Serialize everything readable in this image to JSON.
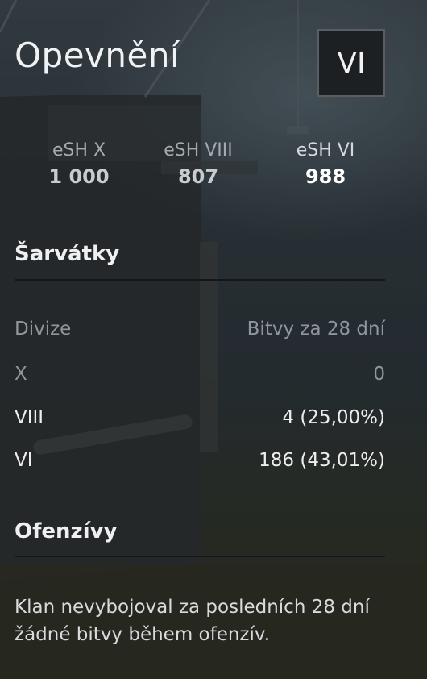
{
  "header": {
    "title": "Opevnění",
    "tier_badge": "VI"
  },
  "elo_ratings": [
    {
      "label": "eSH X",
      "value": "1 000",
      "current": false
    },
    {
      "label": "eSH VIII",
      "value": "807",
      "current": false
    },
    {
      "label": "eSH VI",
      "value": "988",
      "current": true
    }
  ],
  "skirmishes": {
    "title": "Šarvátky",
    "columns": [
      "Divize",
      "Bitvy za 28 dní"
    ],
    "rows": [
      {
        "division": "X",
        "battles": "0"
      },
      {
        "division": "VIII",
        "battles": "4 (25,00%)"
      },
      {
        "division": "VI",
        "battles": "186 (43,01%)"
      }
    ]
  },
  "offensives": {
    "title": "Ofenzívy",
    "text": "Klan nevybojoval za posledních 28 dní žádné bitvy během ofenzív."
  },
  "colors": {
    "text_primary": "#f0f0f0",
    "text_muted": "#8f979d",
    "badge_bg": "#1d2023"
  }
}
